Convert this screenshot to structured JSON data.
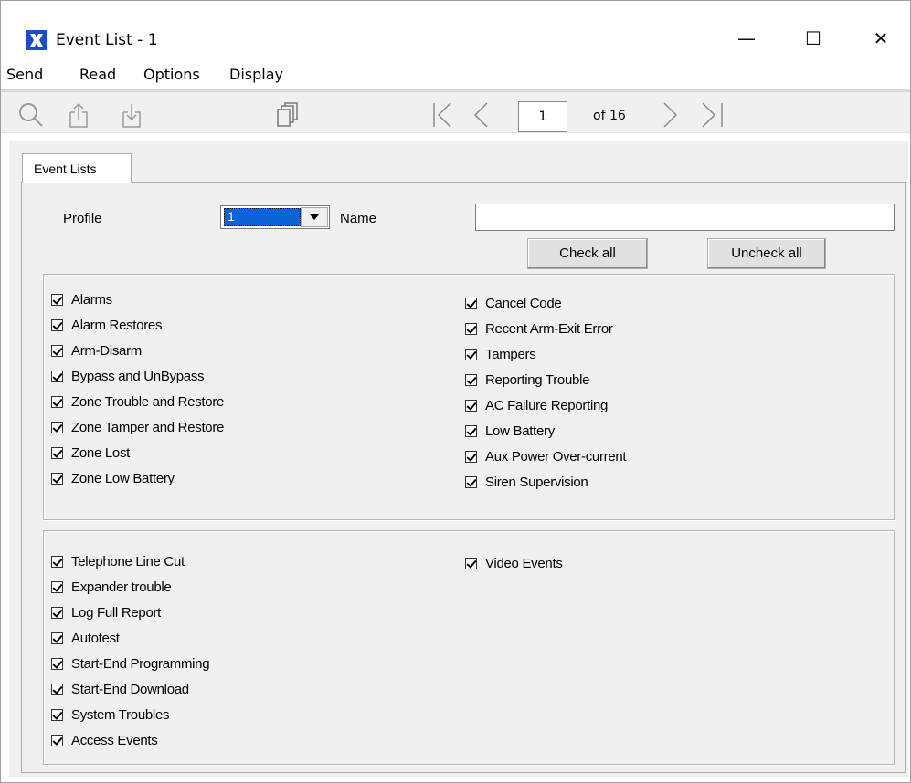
{
  "window": {
    "title": "Event List - 1",
    "minimize_glyph": "—",
    "maximize_glyph": "☐",
    "close_glyph": "✕"
  },
  "menu": [
    "Send",
    "Read",
    "Options",
    "Display"
  ],
  "toolbar": {
    "icons": [
      "search-icon",
      "send-upload-icon",
      "read-download-icon",
      "copy-icon",
      "first-page-icon",
      "previous-page-icon",
      "next-page-icon",
      "last-page-icon"
    ],
    "page_value": "1",
    "page_of": "of 16"
  },
  "tabs": [
    {
      "label": "Event Lists"
    }
  ],
  "form": {
    "profile_label": "Profile",
    "profile_value": "1",
    "name_label": "Name",
    "name_value": "",
    "check_all": "Check all",
    "uncheck_all": "Uncheck all"
  },
  "group1": {
    "left": [
      {
        "label": "Alarms",
        "checked": true
      },
      {
        "label": "Alarm Restores",
        "checked": true
      },
      {
        "label": "Arm-Disarm",
        "checked": true
      },
      {
        "label": "Bypass and UnBypass",
        "checked": true
      },
      {
        "label": "Zone Trouble and Restore",
        "checked": true
      },
      {
        "label": "Zone Tamper and Restore",
        "checked": true
      },
      {
        "label": "Zone Lost",
        "checked": true
      },
      {
        "label": "Zone Low Battery",
        "checked": true
      }
    ],
    "right": [
      {
        "label": "Cancel Code",
        "checked": true
      },
      {
        "label": "Recent Arm-Exit Error",
        "checked": true
      },
      {
        "label": "Tampers",
        "checked": true
      },
      {
        "label": "Reporting Trouble",
        "checked": true
      },
      {
        "label": "AC Failure Reporting",
        "checked": true
      },
      {
        "label": "Low Battery",
        "checked": true
      },
      {
        "label": "Aux Power Over-current",
        "checked": true
      },
      {
        "label": "Siren Supervision",
        "checked": true
      }
    ]
  },
  "group2": {
    "left": [
      {
        "label": "Telephone Line Cut",
        "checked": true
      },
      {
        "label": "Expander trouble",
        "checked": true
      },
      {
        "label": "Log Full Report",
        "checked": true
      },
      {
        "label": "Autotest",
        "checked": true
      },
      {
        "label": "Start-End Programming",
        "checked": true
      },
      {
        "label": "Start-End Download",
        "checked": true
      },
      {
        "label": "System Troubles",
        "checked": true
      },
      {
        "label": "Access Events",
        "checked": true
      }
    ],
    "right": [
      {
        "label": "Video Events",
        "checked": true
      }
    ]
  },
  "colors": {
    "app_icon": "#1a4fc4",
    "selection": "#0a64d8",
    "toolbar_bg": "#f0f0f0",
    "disabled_icon": "#9a9a9a"
  }
}
